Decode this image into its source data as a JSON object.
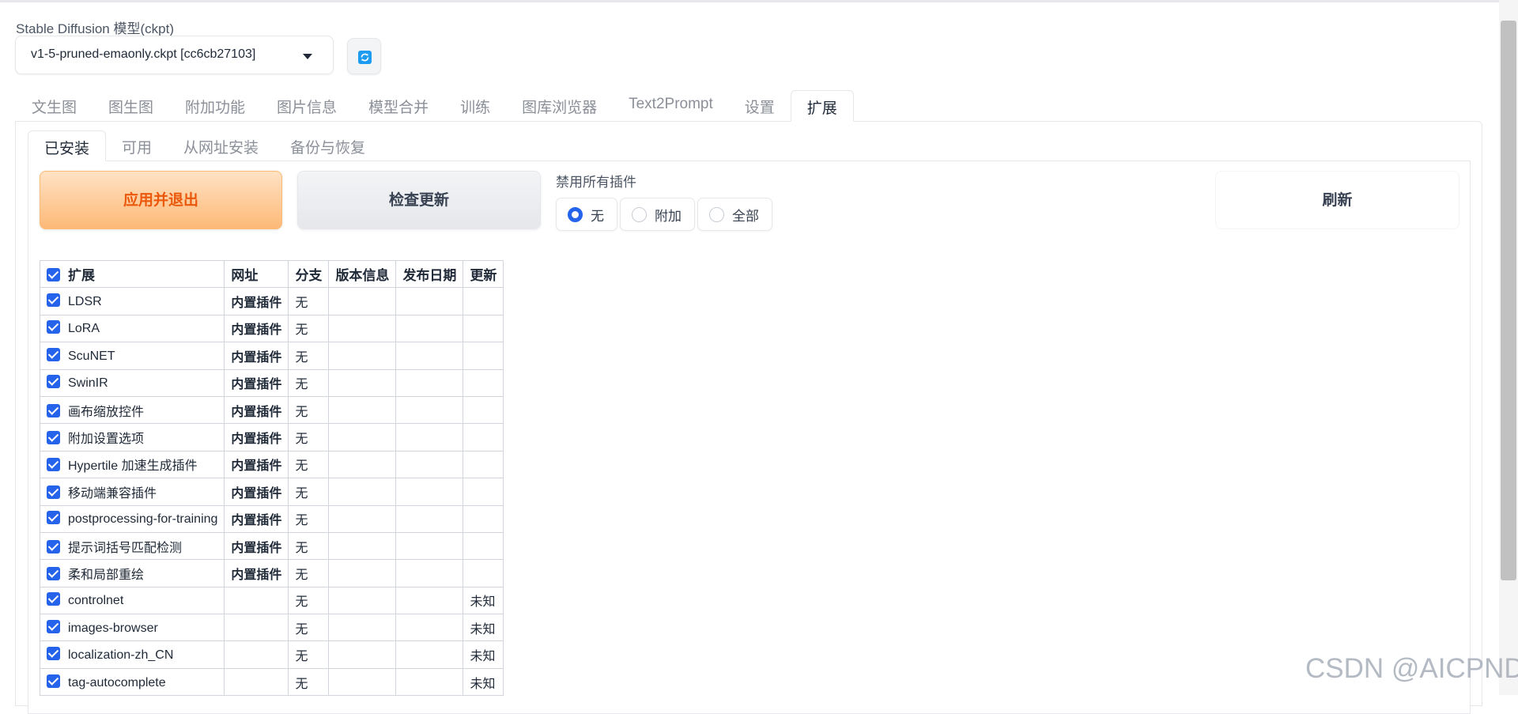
{
  "model": {
    "label": "Stable Diffusion 模型(ckpt)",
    "value": "v1-5-pruned-emaonly.ckpt [cc6cb27103]"
  },
  "main_tabs": [
    {
      "label": "文生图"
    },
    {
      "label": "图生图"
    },
    {
      "label": "附加功能"
    },
    {
      "label": "图片信息"
    },
    {
      "label": "模型合并"
    },
    {
      "label": "训练"
    },
    {
      "label": "图库浏览器"
    },
    {
      "label": "Text2Prompt"
    },
    {
      "label": "设置"
    },
    {
      "label": "扩展"
    }
  ],
  "sub_tabs": [
    {
      "label": "已安装"
    },
    {
      "label": "可用"
    },
    {
      "label": "从网址安装"
    },
    {
      "label": "备份与恢复"
    }
  ],
  "actions": {
    "apply": "应用并退出",
    "check": "检查更新",
    "refresh": "刷新"
  },
  "disable": {
    "label": "禁用所有插件",
    "options": [
      "无",
      "附加",
      "全部"
    ],
    "selected": "无"
  },
  "table": {
    "headers": [
      "扩展",
      "网址",
      "分支",
      "版本信息",
      "发布日期",
      "更新"
    ],
    "rows": [
      {
        "name": "LDSR",
        "url": "内置插件",
        "branch": "无",
        "version": "",
        "date": "",
        "update": ""
      },
      {
        "name": "LoRA",
        "url": "内置插件",
        "branch": "无",
        "version": "",
        "date": "",
        "update": ""
      },
      {
        "name": "ScuNET",
        "url": "内置插件",
        "branch": "无",
        "version": "",
        "date": "",
        "update": ""
      },
      {
        "name": "SwinIR",
        "url": "内置插件",
        "branch": "无",
        "version": "",
        "date": "",
        "update": ""
      },
      {
        "name": "画布缩放控件",
        "url": "内置插件",
        "branch": "无",
        "version": "",
        "date": "",
        "update": ""
      },
      {
        "name": "附加设置选项",
        "url": "内置插件",
        "branch": "无",
        "version": "",
        "date": "",
        "update": ""
      },
      {
        "name": "Hypertile 加速生成插件",
        "url": "内置插件",
        "branch": "无",
        "version": "",
        "date": "",
        "update": ""
      },
      {
        "name": "移动端兼容插件",
        "url": "内置插件",
        "branch": "无",
        "version": "",
        "date": "",
        "update": ""
      },
      {
        "name": "postprocessing-for-training",
        "url": "内置插件",
        "branch": "无",
        "version": "",
        "date": "",
        "update": ""
      },
      {
        "name": "提示词括号匹配检测",
        "url": "内置插件",
        "branch": "无",
        "version": "",
        "date": "",
        "update": ""
      },
      {
        "name": "柔和局部重绘",
        "url": "内置插件",
        "branch": "无",
        "version": "",
        "date": "",
        "update": ""
      },
      {
        "name": "controlnet",
        "url": "",
        "branch": "无",
        "version": "",
        "date": "",
        "update": "未知"
      },
      {
        "name": "images-browser",
        "url": "",
        "branch": "无",
        "version": "",
        "date": "",
        "update": "未知"
      },
      {
        "name": "localization-zh_CN",
        "url": "",
        "branch": "无",
        "version": "",
        "date": "",
        "update": "未知"
      },
      {
        "name": "tag-autocomplete",
        "url": "",
        "branch": "无",
        "version": "",
        "date": "",
        "update": "未知"
      }
    ]
  },
  "watermark": "CSDN @AICPND",
  "colors": {
    "accent": "#2563eb",
    "apply_text": "#ea580c",
    "refresh_icon": "#1d9bf0"
  }
}
